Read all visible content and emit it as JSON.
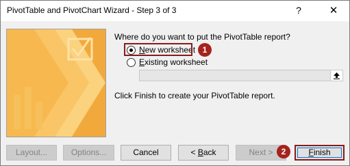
{
  "window": {
    "title": "PivotTable and PivotChart Wizard - Step 3 of 3",
    "help_glyph": "?",
    "close_glyph": "✕"
  },
  "main": {
    "question": "Where do you want to put the PivotTable report?",
    "options": [
      {
        "label_mnemonic": "N",
        "label_rest": "ew worksheet",
        "selected": true
      },
      {
        "label_mnemonic": "E",
        "label_rest": "xisting worksheet",
        "selected": false
      }
    ],
    "range_input": {
      "value": "",
      "placeholder": ""
    },
    "finish_message": "Click Finish to create your PivotTable report."
  },
  "callouts": {
    "one": "1",
    "two": "2"
  },
  "buttons": {
    "layout": "Layout...",
    "options": "Options...",
    "cancel": "Cancel",
    "back_prefix": "< ",
    "back_mnemonic": "B",
    "back_rest": "ack",
    "next": "Next >",
    "finish_mnemonic": "F",
    "finish_rest": "inish"
  },
  "colors": {
    "art_orange": "#f2a93b",
    "callout_red": "#a5231c",
    "highlight_border": "#8b1a1a",
    "focus_blue": "#0078d7"
  },
  "icons": {
    "wizard_art": "pivot-wizard-illustration",
    "collapse": "collapse-dialog-arrow-icon"
  }
}
